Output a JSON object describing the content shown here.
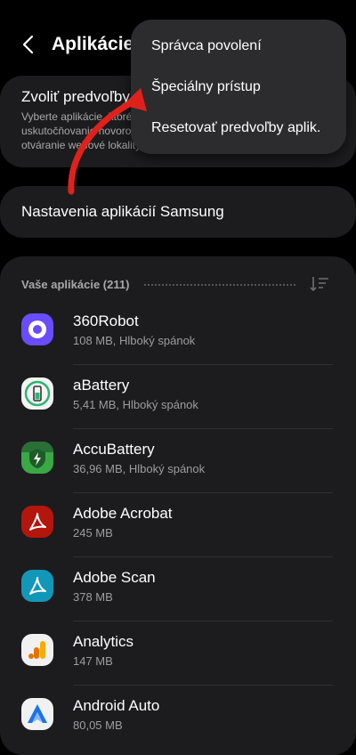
{
  "header": {
    "title": "Aplikácie"
  },
  "card_default_apps": {
    "title": "Zvoliť predvoľby",
    "subtitle": "Vyberte aplikácie, ktoré sa budú používať na uskutočňovanie hovorov, odosielanie správ, otváranie webové lokality a ďalšie."
  },
  "card_samsung": {
    "title": "Nastavenia aplikácií Samsung"
  },
  "apps_section": {
    "label": "Vaše aplikácie (211)",
    "items": [
      {
        "name": "360Robot",
        "details": "108 MB, Hlboký spánok",
        "icon": "360robot-icon"
      },
      {
        "name": "aBattery",
        "details": "5,41 MB, Hlboký spánok",
        "icon": "abattery-icon"
      },
      {
        "name": "AccuBattery",
        "details": "36,96 MB, Hlboký spánok",
        "icon": "accubattery-icon"
      },
      {
        "name": "Adobe Acrobat",
        "details": "245 MB",
        "icon": "adobe-acrobat-icon"
      },
      {
        "name": "Adobe Scan",
        "details": "378 MB",
        "icon": "adobe-scan-icon"
      },
      {
        "name": "Analytics",
        "details": "147 MB",
        "icon": "analytics-icon"
      },
      {
        "name": "Android Auto",
        "details": "80,05 MB",
        "icon": "android-auto-icon"
      }
    ]
  },
  "menu": {
    "items": [
      {
        "label": "Správca povolení"
      },
      {
        "label": "Špeciálny prístup"
      },
      {
        "label": "Resetovať predvoľby aplik."
      }
    ]
  },
  "colors": {
    "background": "#000000",
    "card": "#1c1c1e",
    "menu": "#2c2c2e",
    "annotation_arrow": "#e0211b"
  }
}
